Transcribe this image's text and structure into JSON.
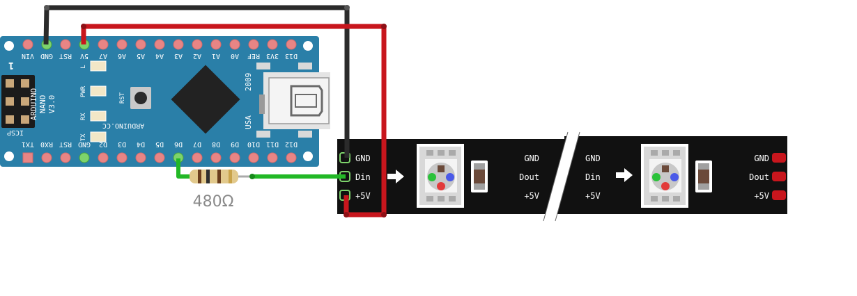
{
  "colors": {
    "board": "#2a7fa8",
    "board_dark": "#1f6d93",
    "pin": "#e88585",
    "pin_active": "#7dd36b",
    "strip": "#111111",
    "wire_black": "#2b2b2b",
    "wire_red": "#c8161d",
    "wire_green": "#22b826",
    "chip": "#222222"
  },
  "arduino": {
    "top_pins": [
      "VIN",
      "GND",
      "RST",
      "5V",
      "A7",
      "A6",
      "A5",
      "A4",
      "A3",
      "A2",
      "A1",
      "A0",
      "REF",
      "3V3",
      "D13"
    ],
    "bottom_pins": [
      "TX1",
      "RX0",
      "RST",
      "GND",
      "D2",
      "D3",
      "D4",
      "D5",
      "D6",
      "D7",
      "D8",
      "D9",
      "D10",
      "D11",
      "D12"
    ],
    "name_line1": "ARDUINO",
    "name_line2": "NANO",
    "name_line3": "V3.0",
    "icsp_label": "ICSP",
    "icsp_pin1": "1",
    "led_labels": [
      "L",
      "PWR",
      "RX",
      "TX"
    ],
    "rst_label": "RST",
    "website": "ARDUINO.CC",
    "year": "2009",
    "country": "USA"
  },
  "resistor": {
    "label": "480Ω"
  },
  "strip": {
    "input_labels": [
      "GND",
      "Din",
      "+5V"
    ],
    "segment1_out_labels": [
      "GND",
      "Dout",
      "+5V"
    ],
    "segment2_in_labels": [
      "GND",
      "Din",
      "+5V"
    ],
    "segment2_out_labels": [
      "GND",
      "Dout",
      "+5V"
    ],
    "arrow_icon": "right-arrow-icon",
    "led_icon": "rgb-led-icon"
  }
}
